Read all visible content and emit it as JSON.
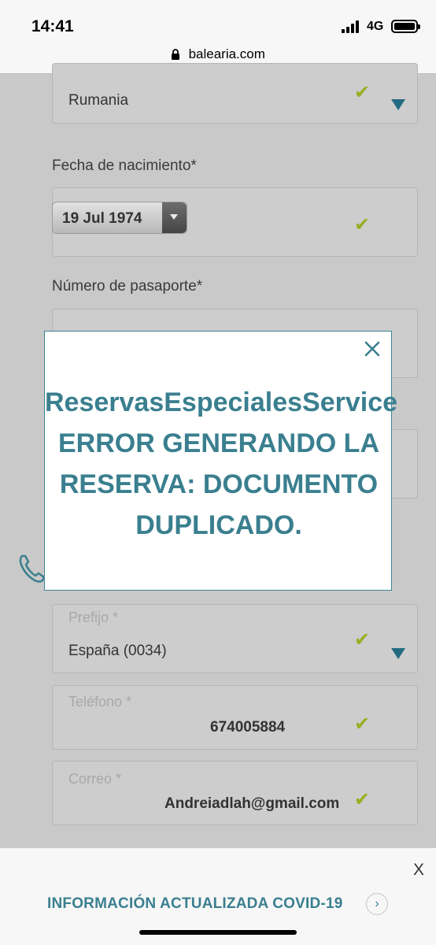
{
  "status_bar": {
    "time": "14:41",
    "network": "4G"
  },
  "browser": {
    "url": "balearia.com"
  },
  "form": {
    "nationality": {
      "value": "Rumania"
    },
    "birth_date": {
      "label": "Fecha de nacimiento*",
      "value": "19 Jul 1974"
    },
    "passport": {
      "label": "Número de pasaporte*"
    },
    "prefix": {
      "placeholder": "Prefijo *",
      "value": "España (0034)"
    },
    "phone": {
      "placeholder": "Teléfono *",
      "value": "674005884"
    },
    "email": {
      "placeholder": "Correo *",
      "value": "Andreiadlah@gmail.com"
    }
  },
  "modal": {
    "message_lines": [
      "ReservasEspecialesService",
      "ERROR GENERANDO LA",
      "RESERVA: DOCUMENTO",
      "DUPLICADO."
    ]
  },
  "banner": {
    "link": "INFORMACIÓN ACTUALIZADA COVID-19",
    "close": "X",
    "arrow": "›"
  },
  "icons": {
    "check": "✔",
    "accent": "#3a7f8f",
    "check_color": "#9aae22",
    "caret_color": "#246b82"
  }
}
